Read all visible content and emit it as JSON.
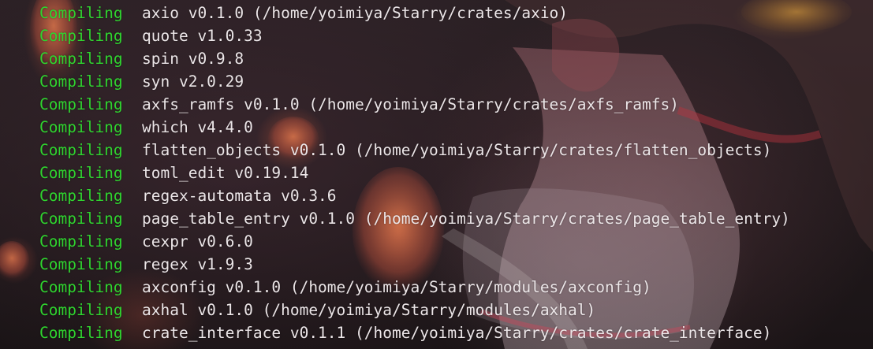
{
  "terminal": {
    "colors": {
      "keyword": "#2fd42f",
      "text": "#ece6e8",
      "background": "#221a1d"
    },
    "lines": [
      {
        "status": "Compiling",
        "text": "axio v0.1.0 (/home/yoimiya/Starry/crates/axio)"
      },
      {
        "status": "Compiling",
        "text": "quote v1.0.33"
      },
      {
        "status": "Compiling",
        "text": "spin v0.9.8"
      },
      {
        "status": "Compiling",
        "text": "syn v2.0.29"
      },
      {
        "status": "Compiling",
        "text": "axfs_ramfs v0.1.0 (/home/yoimiya/Starry/crates/axfs_ramfs)"
      },
      {
        "status": "Compiling",
        "text": "which v4.4.0"
      },
      {
        "status": "Compiling",
        "text": "flatten_objects v0.1.0 (/home/yoimiya/Starry/crates/flatten_objects)"
      },
      {
        "status": "Compiling",
        "text": "toml_edit v0.19.14"
      },
      {
        "status": "Compiling",
        "text": "regex-automata v0.3.6"
      },
      {
        "status": "Compiling",
        "text": "page_table_entry v0.1.0 (/home/yoimiya/Starry/crates/page_table_entry)"
      },
      {
        "status": "Compiling",
        "text": "cexpr v0.6.0"
      },
      {
        "status": "Compiling",
        "text": "regex v1.9.3"
      },
      {
        "status": "Compiling",
        "text": "axconfig v0.1.0 (/home/yoimiya/Starry/modules/axconfig)"
      },
      {
        "status": "Compiling",
        "text": "axhal v0.1.0 (/home/yoimiya/Starry/modules/axhal)"
      },
      {
        "status": "Compiling",
        "text": "crate_interface v0.1.1 (/home/yoimiya/Starry/crates/crate_interface)"
      }
    ]
  }
}
